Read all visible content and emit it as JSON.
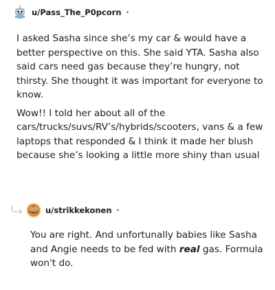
{
  "comments": [
    {
      "username": "u/Pass_The_P0pcorn",
      "meta_dot": "•",
      "avatar_icon": "robot-avatar-icon",
      "paragraphs": [
        "I asked Sasha since she’s my car & would have a better perspective on this. She said YTA. Sasha also said cars need gas because they’re hungry, not thirsty. She thought it was important for everyone to know.",
        "Wow!! I told her about all of the cars/trucks/suvs/RV’s/hybrids/scooters, vans & a few laptops that responded & I think it made her blush because she’s looking a little more shiny than usual"
      ]
    },
    {
      "username": "u/strikkekonen",
      "meta_dot": "•",
      "avatar_icon": "cookie-avatar-icon",
      "reply_text_before": "You are right. And unfortunally babies like Sasha and Angie needs to be fed with ",
      "reply_text_emphasis": "real",
      "reply_text_after": " gas. Formula won't do."
    }
  ],
  "colors": {
    "text": "#1c1c1c",
    "meta": "#7c7c7c",
    "connector": "#c9c9c9"
  }
}
